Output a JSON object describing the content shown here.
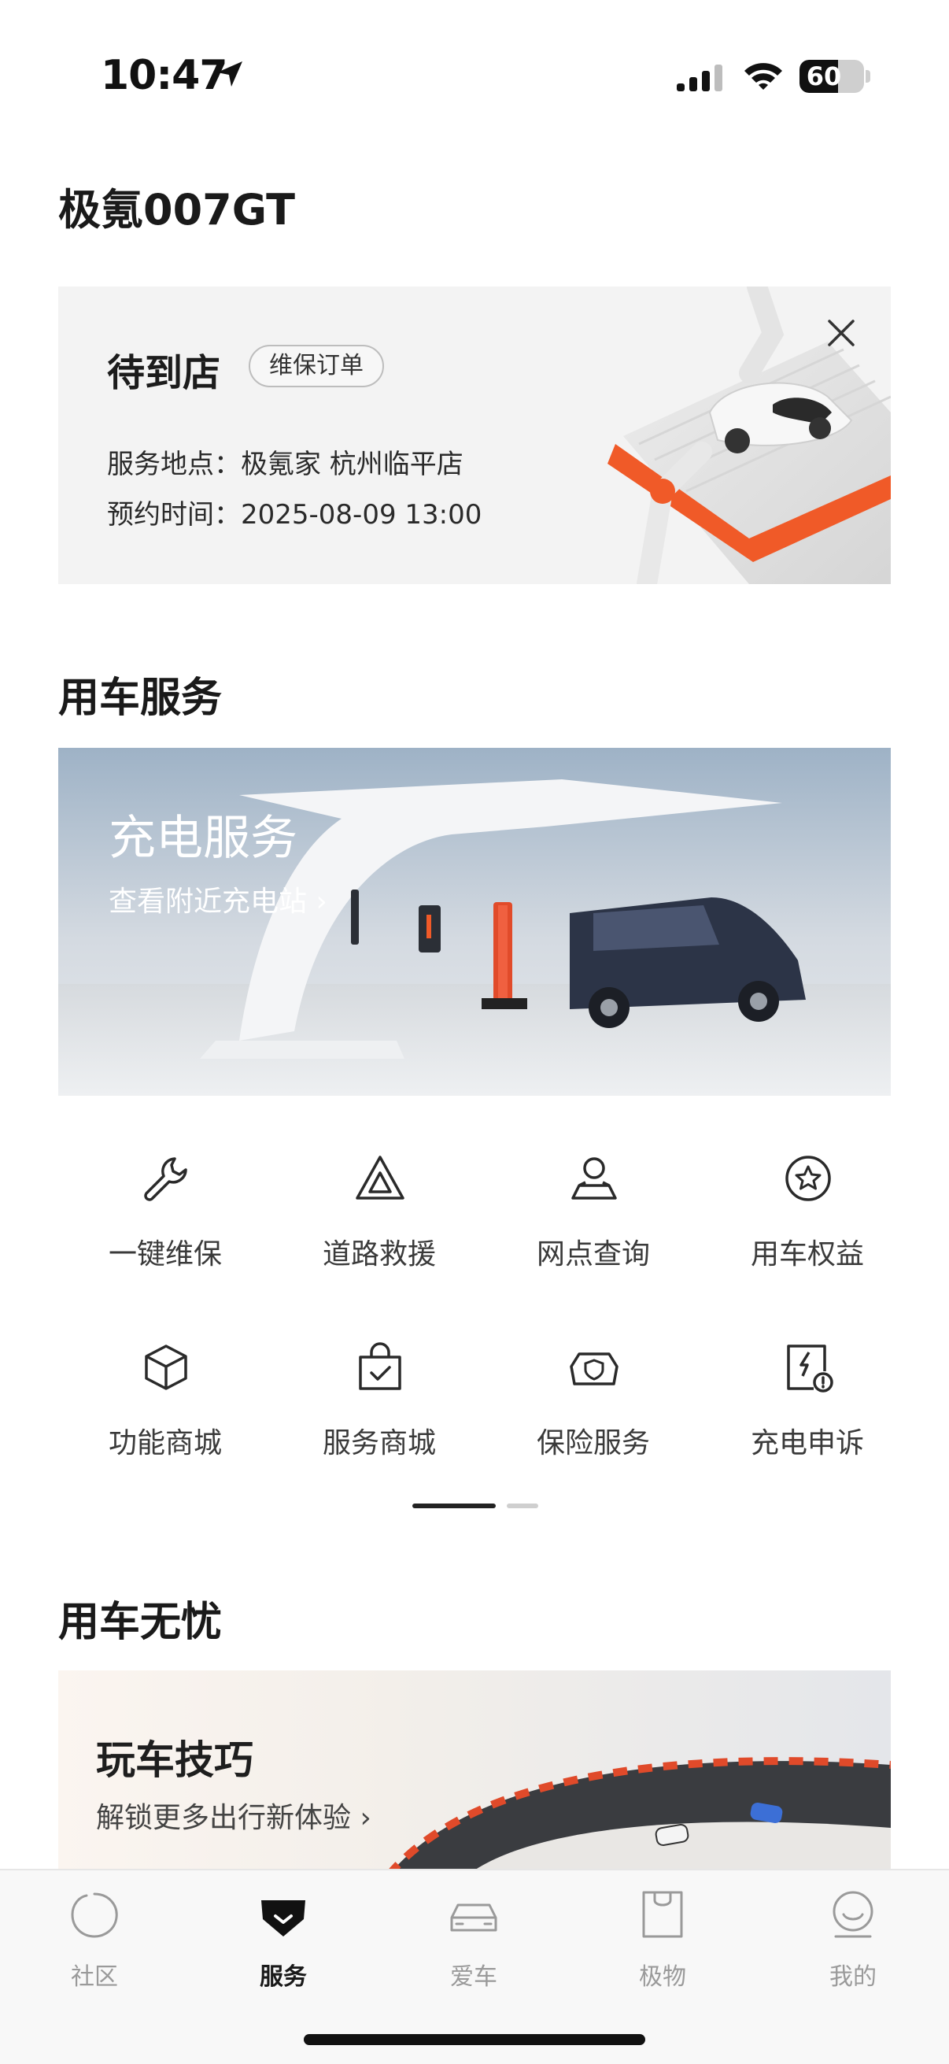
{
  "status_bar": {
    "time": "10:47",
    "battery": "60",
    "battery_level": 0.6
  },
  "page_title": "极氪007GT",
  "appointment": {
    "status": "待到店",
    "tag": "维保订单",
    "location_label": "服务地点：",
    "location_value": "极氪家 杭州临平店",
    "time_label": "预约时间：",
    "time_value": "2025-08-09 13:00"
  },
  "services_section": {
    "title": "用车服务",
    "banner": {
      "title": "充电服务",
      "subtitle": "查看附近充电站 ›"
    },
    "items": [
      {
        "label": "一键维保",
        "icon": "wrench-icon"
      },
      {
        "label": "道路救援",
        "icon": "warning-triangle-icon"
      },
      {
        "label": "网点查询",
        "icon": "location-person-icon"
      },
      {
        "label": "用车权益",
        "icon": "star-badge-icon"
      },
      {
        "label": "功能商城",
        "icon": "cube-icon"
      },
      {
        "label": "服务商城",
        "icon": "shopping-bag-check-icon"
      },
      {
        "label": "保险服务",
        "icon": "car-shield-icon"
      },
      {
        "label": "充电申诉",
        "icon": "charge-alert-icon"
      }
    ],
    "pager": {
      "current": 1,
      "total": 2
    }
  },
  "worry_free_section": {
    "title": "用车无忧",
    "tips": {
      "title": "玩车技巧",
      "subtitle": "解锁更多出行新体验 ›"
    }
  },
  "tab_bar": {
    "tabs": [
      {
        "label": "社区",
        "icon": "community-icon",
        "active": false
      },
      {
        "label": "服务",
        "icon": "service-icon",
        "active": true
      },
      {
        "label": "爱车",
        "icon": "car-icon",
        "active": false
      },
      {
        "label": "极物",
        "icon": "shop-bag-icon",
        "active": false
      },
      {
        "label": "我的",
        "icon": "profile-icon",
        "active": false
      }
    ]
  },
  "colors": {
    "accent_orange": "#f05a28",
    "text_primary": "#1a1a1a",
    "tab_inactive": "#9a9a9a"
  }
}
